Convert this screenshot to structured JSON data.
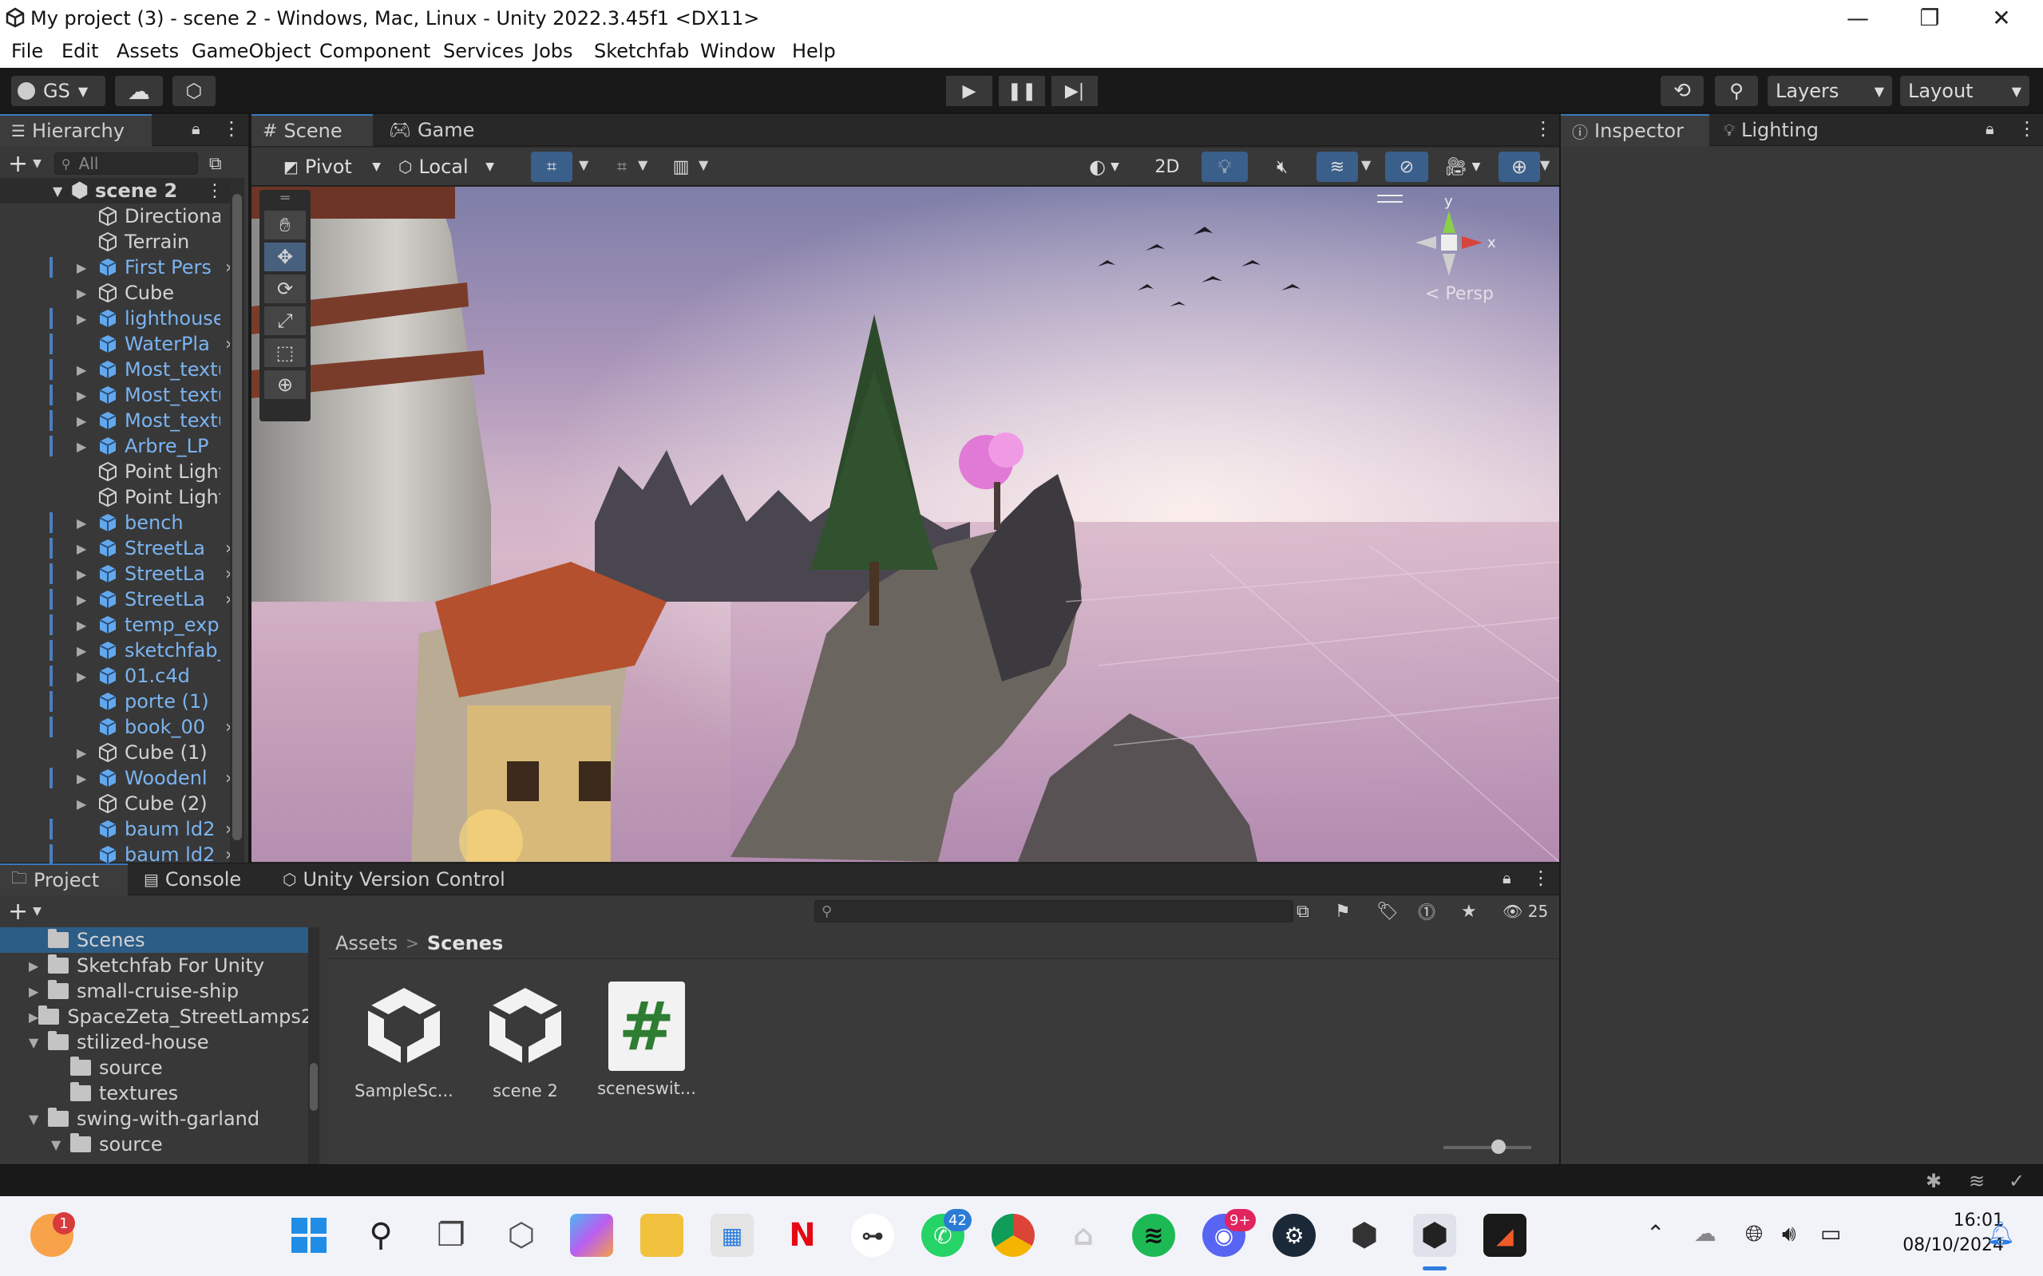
{
  "window": {
    "title": "My project (3) - scene 2 - Windows, Mac, Linux - Unity 2022.3.45f1 <DX11>",
    "minimize": "—",
    "maximize": "❐",
    "close": "✕"
  },
  "menu": [
    "File",
    "Edit",
    "Assets",
    "GameObject",
    "Component",
    "Services",
    "Jobs",
    "Sketchfab",
    "Window",
    "Help"
  ],
  "toolbar": {
    "account": "GS",
    "layers": "Layers",
    "layout": "Layout"
  },
  "hierarchy": {
    "tab": "Hierarchy",
    "search_placeholder": "All",
    "scene_name": "scene 2",
    "items": [
      {
        "label": "Directional",
        "prefab": false,
        "arrow": false,
        "more": false
      },
      {
        "label": "Terrain",
        "prefab": false,
        "arrow": false,
        "more": false
      },
      {
        "label": "First Pers",
        "prefab": true,
        "arrow": true,
        "more": true
      },
      {
        "label": "Cube",
        "prefab": false,
        "arrow": true,
        "more": false
      },
      {
        "label": "lighthouseF",
        "prefab": true,
        "arrow": true,
        "more": false
      },
      {
        "label": "WaterPla",
        "prefab": true,
        "arrow": false,
        "more": true
      },
      {
        "label": "Most_textur",
        "prefab": true,
        "arrow": true,
        "more": false
      },
      {
        "label": "Most_textur",
        "prefab": true,
        "arrow": true,
        "more": false
      },
      {
        "label": "Most_textur",
        "prefab": true,
        "arrow": true,
        "more": false
      },
      {
        "label": "Arbre_LP",
        "prefab": true,
        "arrow": true,
        "more": false
      },
      {
        "label": "Point Light",
        "prefab": false,
        "arrow": false,
        "more": false
      },
      {
        "label": "Point Light",
        "prefab": false,
        "arrow": false,
        "more": false
      },
      {
        "label": "bench",
        "prefab": true,
        "arrow": true,
        "more": false
      },
      {
        "label": "StreetLa",
        "prefab": true,
        "arrow": true,
        "more": true
      },
      {
        "label": "StreetLa",
        "prefab": true,
        "arrow": true,
        "more": true
      },
      {
        "label": "StreetLa",
        "prefab": true,
        "arrow": true,
        "more": true
      },
      {
        "label": "temp_expor",
        "prefab": true,
        "arrow": true,
        "more": false
      },
      {
        "label": "sketchfab_r",
        "prefab": true,
        "arrow": true,
        "more": false
      },
      {
        "label": "01.c4d",
        "prefab": true,
        "arrow": true,
        "more": false
      },
      {
        "label": "porte (1)",
        "prefab": true,
        "arrow": false,
        "more": false
      },
      {
        "label": "book_00",
        "prefab": true,
        "arrow": false,
        "more": true
      },
      {
        "label": "Cube (1)",
        "prefab": false,
        "arrow": true,
        "more": false
      },
      {
        "label": "Woodenl",
        "prefab": true,
        "arrow": true,
        "more": true
      },
      {
        "label": "Cube (2)",
        "prefab": false,
        "arrow": true,
        "more": false
      },
      {
        "label": "baum ld2",
        "prefab": true,
        "arrow": false,
        "more": true
      },
      {
        "label": "baum ld2",
        "prefab": true,
        "arrow": false,
        "more": true
      }
    ]
  },
  "scene": {
    "tab_scene": "Scene",
    "tab_game": "Game",
    "pivot": "Pivot",
    "local": "Local",
    "mode_2d": "2D",
    "persp": "< Persp",
    "gizmo_y": "y",
    "gizmo_x": "x"
  },
  "inspector": {
    "tab_inspector": "Inspector",
    "tab_lighting": "Lighting"
  },
  "project": {
    "tab_project": "Project",
    "tab_console": "Console",
    "tab_uvc": "Unity Version Control",
    "hidden_count": "25",
    "breadcrumb_root": "Assets",
    "breadcrumb_sep": ">",
    "breadcrumb_current": "Scenes",
    "tree": [
      {
        "label": "Scenes",
        "indent": 0,
        "arrow": "",
        "open": false,
        "selected": true
      },
      {
        "label": "Sketchfab For Unity",
        "indent": 0,
        "arrow": "▶",
        "open": false,
        "selected": false
      },
      {
        "label": "small-cruise-ship",
        "indent": 0,
        "arrow": "▶",
        "open": false,
        "selected": false
      },
      {
        "label": "SpaceZeta_StreetLamps2",
        "indent": 0,
        "arrow": "▶",
        "open": false,
        "selected": false
      },
      {
        "label": "stilized-house",
        "indent": 0,
        "arrow": "▼",
        "open": true,
        "selected": false
      },
      {
        "label": "source",
        "indent": 1,
        "arrow": "",
        "open": false,
        "selected": false
      },
      {
        "label": "textures",
        "indent": 1,
        "arrow": "",
        "open": false,
        "selected": false
      },
      {
        "label": "swing-with-garland",
        "indent": 0,
        "arrow": "▼",
        "open": true,
        "selected": false
      },
      {
        "label": "source",
        "indent": 1,
        "arrow": "▼",
        "open": true,
        "selected": false
      }
    ],
    "assets": [
      {
        "label": "SampleSc...",
        "kind": "unity-scene"
      },
      {
        "label": "scene 2",
        "kind": "unity-scene"
      },
      {
        "label": "sceneswit...",
        "kind": "csharp-script"
      }
    ]
  },
  "taskbar": {
    "badge_weather": "1",
    "badge_whatsapp": "42",
    "badge_discord": "9+",
    "time": "16:01",
    "date": "08/10/2024"
  }
}
